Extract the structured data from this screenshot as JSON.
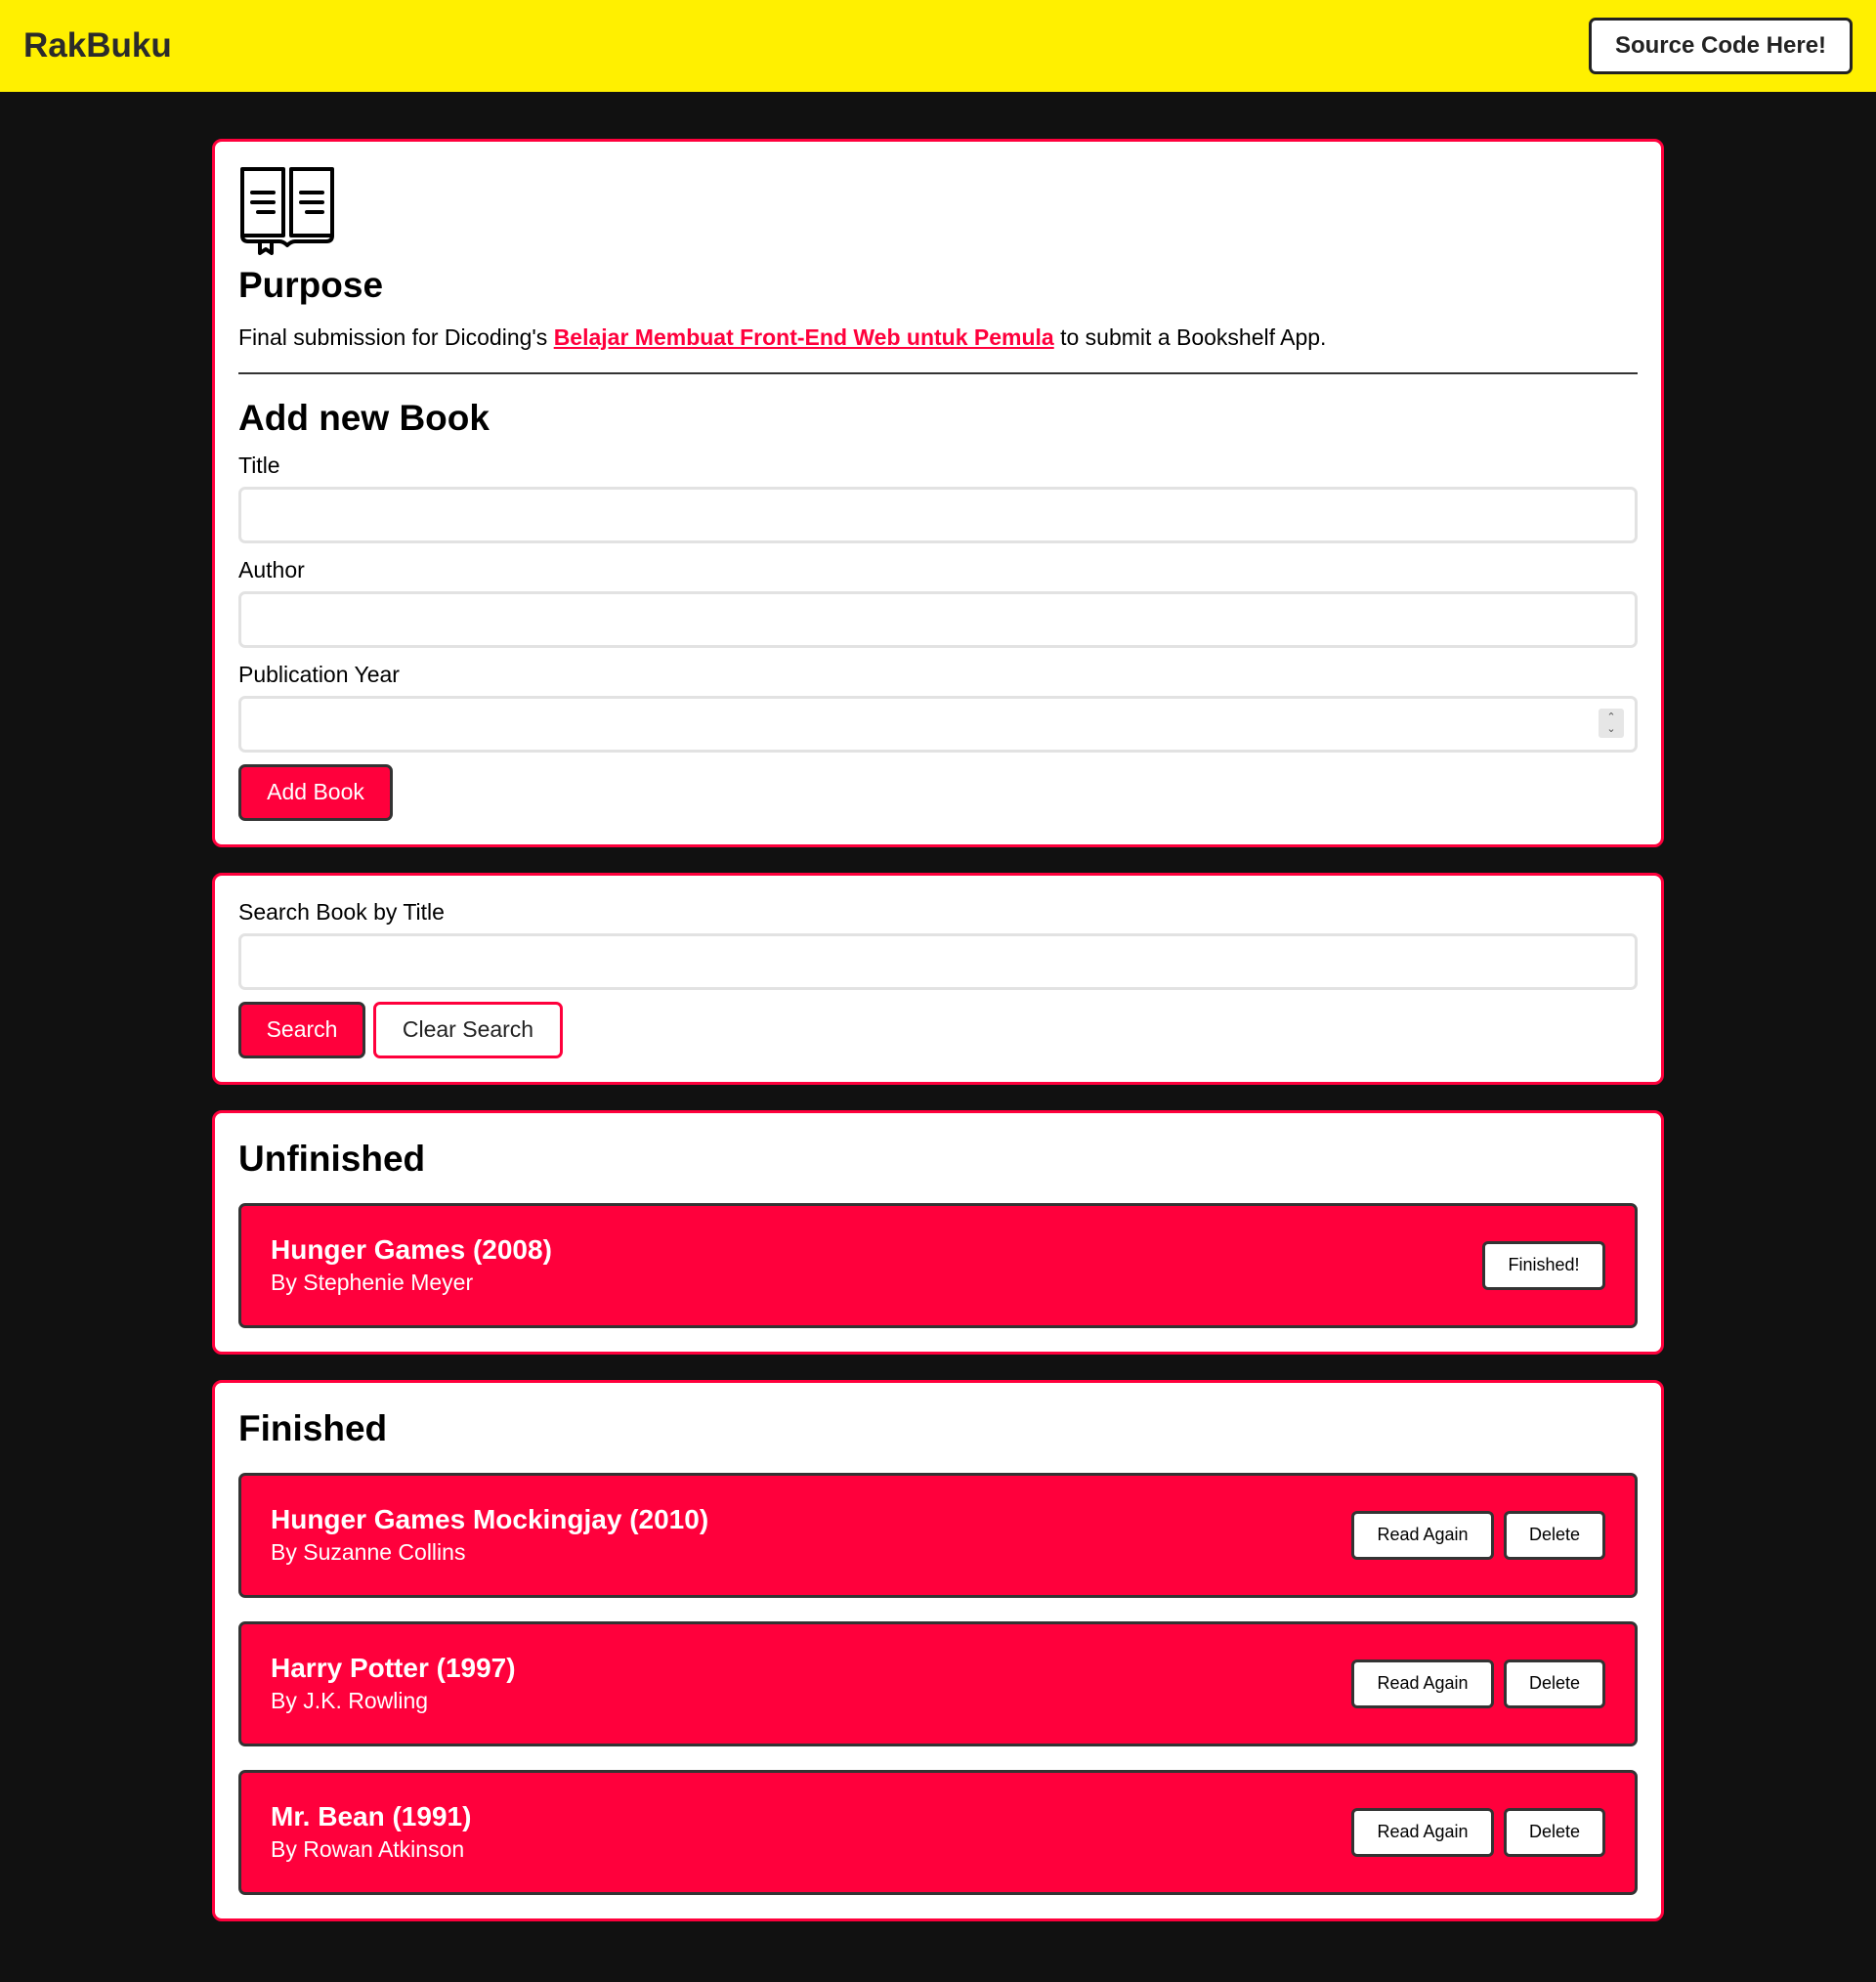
{
  "header": {
    "brand": "RakBuku",
    "source_button": "Source Code Here!"
  },
  "purpose": {
    "icon": "open-book-icon",
    "title": "Purpose",
    "text_before": "Final submission for Dicoding's ",
    "link_text": "Belajar Membuat Front-End Web untuk Pemula",
    "text_after": " to submit a Bookshelf App."
  },
  "add_book": {
    "title": "Add new Book",
    "title_label": "Title",
    "title_value": "",
    "author_label": "Author",
    "author_value": "",
    "year_label": "Publication Year",
    "year_value": "",
    "submit_label": "Add Book"
  },
  "search": {
    "label": "Search Book by Title",
    "value": "",
    "search_button": "Search",
    "clear_button": "Clear Search"
  },
  "unfinished": {
    "title": "Unfinished",
    "books": [
      {
        "title": "Hunger Games (2008)",
        "author": "By Stephenie Meyer",
        "action": "Finished!"
      }
    ]
  },
  "finished": {
    "title": "Finished",
    "books": [
      {
        "title": "Hunger Games Mockingjay (2010)",
        "author": "By Suzanne Collins",
        "action_read": "Read Again",
        "action_delete": "Delete"
      },
      {
        "title": "Harry Potter (1997)",
        "author": "By J.K. Rowling",
        "action_read": "Read Again",
        "action_delete": "Delete"
      },
      {
        "title": "Mr. Bean (1991)",
        "author": "By Rowan Atkinson",
        "action_read": "Read Again",
        "action_delete": "Delete"
      }
    ]
  },
  "colors": {
    "header_bg": "#fff000",
    "accent": "#ff003c",
    "page_bg": "#111111"
  }
}
